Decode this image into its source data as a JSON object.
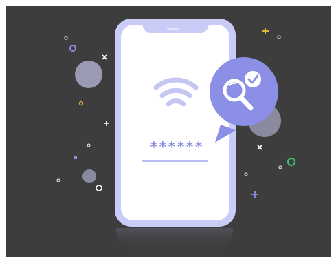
{
  "illustration": {
    "background_color": "#3d3d3d",
    "accent_color": "#8b8fe6",
    "phone_frame_color": "#c9ccf6",
    "phone_screen_color": "#ffffff",
    "password_mask": "******",
    "icons": [
      "wifi-icon",
      "magnifier-icon",
      "checkmark-icon"
    ]
  }
}
